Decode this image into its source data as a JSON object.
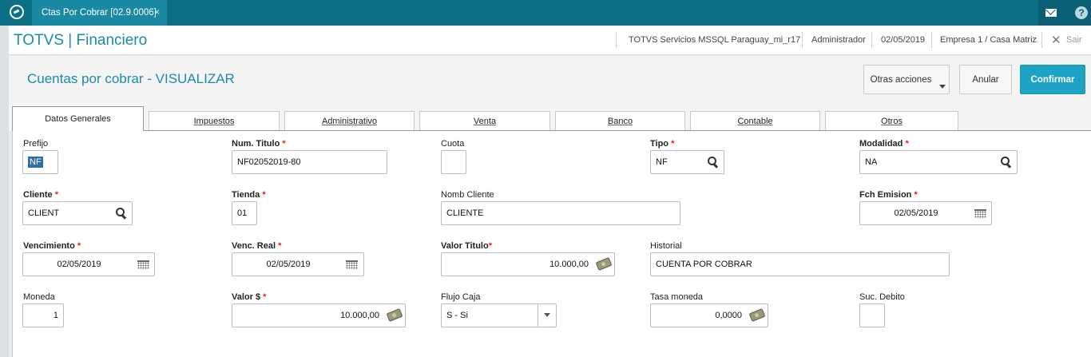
{
  "topbar": {
    "tab_label": "Ctas Por Cobrar [02.9.0006]",
    "tab_close": "×",
    "help_label": "?"
  },
  "header": {
    "app_title": "TOTVS | Financiero",
    "environment": "TOTVS Servicios MSSQL Paraguay_mi_r17",
    "user": "Administrador",
    "date": "02/05/2019",
    "company": "Empresa 1 / Casa Matriz",
    "exit_symbol": "✕",
    "exit_label": "Sair"
  },
  "page": {
    "title": "Cuentas por cobrar - VISUALIZAR",
    "buttons": {
      "otras": "Otras acciones",
      "anular": "Anular",
      "confirmar": "Confirmar"
    }
  },
  "tabs": [
    "Datos Generales",
    "Impuestos",
    "Administrativo",
    "Venta",
    "Banco",
    "Contable",
    "Otros"
  ],
  "form": {
    "prefijo": {
      "label": "Prefijo",
      "value": "NF"
    },
    "num_titulo": {
      "label": "Num. Titulo",
      "value": "NF02052019-80"
    },
    "cuota": {
      "label": "Cuota",
      "value": ""
    },
    "tipo": {
      "label": "Tipo",
      "value": "NF"
    },
    "modalidad": {
      "label": "Modalidad",
      "value": "NA"
    },
    "cliente": {
      "label": "Cliente",
      "value": "CLIENT"
    },
    "tienda": {
      "label": "Tienda",
      "value": "01"
    },
    "nomb_cliente": {
      "label": "Nomb Cliente",
      "value": "CLIENTE"
    },
    "fch_emision": {
      "label": "Fch Emision",
      "value": "02/05/2019"
    },
    "vencimiento": {
      "label": "Vencimiento",
      "value": "02/05/2019"
    },
    "venc_real": {
      "label": "Venc. Real",
      "value": "02/05/2019"
    },
    "valor_titulo": {
      "label": "Valor Titulo",
      "value": "10.000,00"
    },
    "historial": {
      "label": "Historial",
      "value": "CUENTA POR COBRAR"
    },
    "moneda": {
      "label": "Moneda",
      "value": "1"
    },
    "valor_dolar": {
      "label": "Valor $",
      "value": "10.000,00"
    },
    "flujo_caja": {
      "label": "Flujo Caja",
      "value": "S - Si"
    },
    "tasa_moneda": {
      "label": "Tasa moneda",
      "value": "0,0000"
    },
    "suc_debito": {
      "label": "Suc. Debito",
      "value": ""
    }
  },
  "required_mark": "*",
  "colors": {
    "topbar": "#0c6f86",
    "accent": "#1c8aa8",
    "confirm_button": "#1da3c6",
    "required": "#e02020"
  },
  "icons": {
    "search": "search-icon",
    "calendar": "calendar-icon",
    "money": "money-icon",
    "dropdown": "chevron-down-icon",
    "mail": "mail-icon",
    "help": "help-icon",
    "close": "close-icon"
  }
}
